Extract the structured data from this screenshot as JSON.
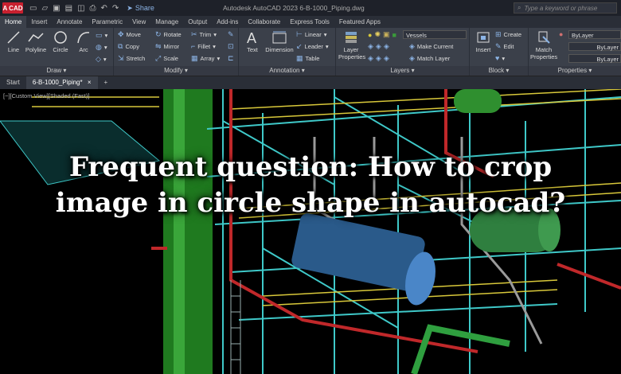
{
  "app": {
    "logo": "A CAD",
    "window_title": "Autodesk AutoCAD 2023      6-B-1000_Piping.dwg",
    "share_label": "Share",
    "search_placeholder": "Type a keyword or phrase"
  },
  "ribbon_tabs": [
    "Home",
    "Insert",
    "Annotate",
    "Parametric",
    "View",
    "Manage",
    "Output",
    "Add-ins",
    "Collaborate",
    "Express Tools",
    "Featured Apps"
  ],
  "draw_panel": {
    "title": "Draw",
    "line": "Line",
    "polyline": "Polyline",
    "circle": "Circle",
    "arc": "Arc"
  },
  "modify_panel": {
    "title": "Modify",
    "move": "Move",
    "rotate": "Rotate",
    "trim": "Trim",
    "copy": "Copy",
    "mirror": "Mirror",
    "fillet": "Fillet",
    "stretch": "Stretch",
    "scale": "Scale",
    "array": "Array"
  },
  "annotation_panel": {
    "title": "Annotation",
    "text": "Text",
    "dimension": "Dimension",
    "linear": "Linear",
    "leader": "Leader",
    "table": "Table"
  },
  "layers_panel": {
    "title": "Layers",
    "layer_properties": "Layer Properties",
    "current_layer": "Vessels",
    "make_current": "Make Current",
    "match_layer": "Match Layer"
  },
  "block_panel": {
    "title": "Block",
    "insert": "Insert",
    "create": "Create",
    "edit": "Edit"
  },
  "properties_panel": {
    "title": "Properties",
    "match_properties": "Match Properties",
    "bylayer1": "ByLayer",
    "bylayer2": "ByLayer",
    "bylayer3": "ByLayer"
  },
  "document_tabs": {
    "start": "Start",
    "active": "6-B-1000_Piping*",
    "close": "×",
    "add": "+"
  },
  "viewport_label": "[−][Custom View][Shaded (Fast)]",
  "headline": {
    "line1": "Frequent question: How to crop",
    "line2": "image in circle shape in autocad?"
  },
  "colors": {
    "accent": "#8cb4e6",
    "logo": "#c8202f",
    "ribbon": "#3b404a",
    "structure_cyan": "#3fc9c9",
    "structure_yellow": "#d8c83a",
    "pipe_green": "#2a8a2a",
    "pipe_red": "#c0282a",
    "vessel_blue": "#4a86c8"
  }
}
